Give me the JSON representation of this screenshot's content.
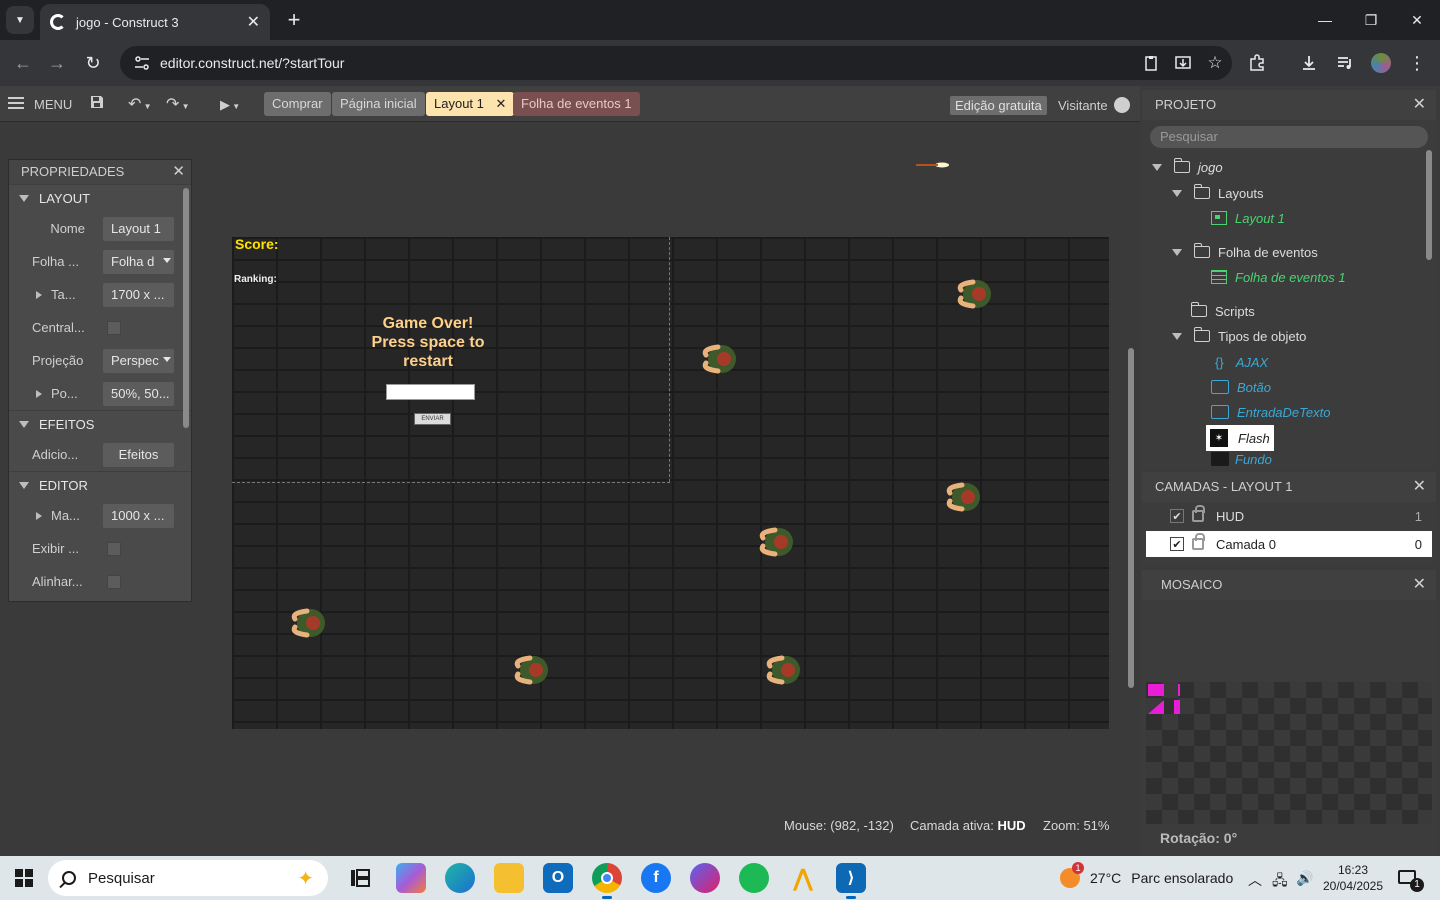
{
  "browser": {
    "tab_title": "jogo - Construct 3",
    "tab_close": "✕",
    "new_tab": "+",
    "url": "editor.construct.net/?startTour",
    "window_minimize": "—",
    "window_maximize": "❐",
    "window_close": "✕"
  },
  "editor": {
    "menu_label": "MENU",
    "tabs": [
      {
        "label": "Comprar"
      },
      {
        "label": "Página inicial"
      },
      {
        "label": "Layout 1",
        "close": "✕"
      },
      {
        "label": "Folha de eventos 1"
      }
    ],
    "free_edition": "Edição gratuita",
    "visitor": "Visitante"
  },
  "properties": {
    "title": "PROPRIEDADES",
    "close": "✕",
    "sections": {
      "layout": "LAYOUT",
      "effects": "EFEITOS",
      "editor": "EDITOR"
    },
    "rows": {
      "name_label": "Nome",
      "name_value": "Layout 1",
      "sheet_label": "Folha ...",
      "sheet_value": "Folha d",
      "size_label": "Ta...",
      "size_value": "1700 x ...",
      "unbounded_label": "Central...",
      "projection_label": "Projeção",
      "projection_value": "Perspec",
      "vanishing_label": "Po...",
      "vanishing_value": "50%, 50...",
      "add_effects_label": "Adicio...",
      "add_effects_value": "Efeitos",
      "margins_label": "Ma...",
      "margins_value": "1000 x ...",
      "show_label": "Exibir ...",
      "align_label": "Alinhar..."
    }
  },
  "canvas": {
    "score_text": "Score:",
    "ranking_text": "Ranking:",
    "gameover_line1": "Game Over!",
    "gameover_line2": "Press space to",
    "gameover_line3": "restart",
    "submit_button": "ENVIAR"
  },
  "statusbar": {
    "mouse": "Mouse: (982, -132)",
    "active_layer_label": "Camada ativa:",
    "active_layer_value": "HUD",
    "zoom": "Zoom: 51%"
  },
  "project": {
    "title": "PROJETO",
    "close": "✕",
    "search_placeholder": "Pesquisar",
    "root": "jogo",
    "layouts_folder": "Layouts",
    "layout_item": "Layout 1",
    "events_folder": "Folha de eventos",
    "events_item": "Folha de eventos 1",
    "scripts_folder": "Scripts",
    "object_types_folder": "Tipos de objeto",
    "objects": [
      "AJAX",
      "Botão",
      "EntradaDeTexto",
      "Flash",
      "Fundo"
    ]
  },
  "layers": {
    "title": "CAMADAS - LAYOUT 1",
    "close": "✕",
    "items": [
      {
        "name": "HUD",
        "index": "1",
        "check": "✔"
      },
      {
        "name": "Camada 0",
        "index": "0",
        "check": "✔"
      }
    ]
  },
  "tilemap": {
    "title": "MOSAICO",
    "close": "✕",
    "rotation": "Rotação: 0°"
  },
  "taskbar": {
    "search_placeholder": "Pesquisar",
    "weather_temp": "27°C",
    "weather_desc": "Parc ensolarado",
    "weather_badge": "1",
    "time": "16:23",
    "date": "20/04/2025",
    "notifications": "1"
  },
  "colors": {
    "active_tab": "#fde3ad",
    "score_yellow": "#ffe300",
    "gameover_orange": "#ffd08a",
    "tree_green": "#49d470",
    "tree_blue": "#39a9d6",
    "tile_magenta": "#e81ed6"
  }
}
